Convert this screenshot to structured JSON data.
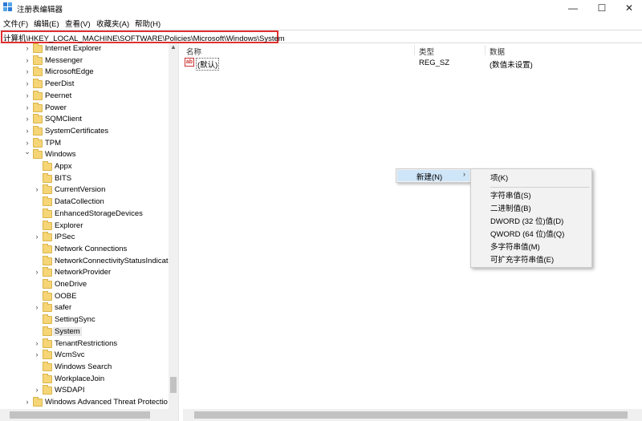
{
  "window": {
    "title": "注册表编辑器",
    "min_glyph": "—",
    "max_glyph": "☐",
    "close_glyph": "✕"
  },
  "menubar": [
    "文件(F)",
    "编辑(E)",
    "查看(V)",
    "收藏夹(A)",
    "帮助(H)"
  ],
  "address": "计算机\\HKEY_LOCAL_MACHINE\\SOFTWARE\\Policies\\Microsoft\\Windows\\System",
  "tree": [
    {
      "label": "Internet Explorer",
      "expandable": true,
      "level": 0
    },
    {
      "label": "Messenger",
      "expandable": true,
      "level": 0
    },
    {
      "label": "MicrosoftEdge",
      "expandable": true,
      "level": 0
    },
    {
      "label": "PeerDist",
      "expandable": true,
      "level": 0
    },
    {
      "label": "Peernet",
      "expandable": true,
      "level": 0
    },
    {
      "label": "Power",
      "expandable": true,
      "level": 0
    },
    {
      "label": "SQMClient",
      "expandable": true,
      "level": 0
    },
    {
      "label": "SystemCertificates",
      "expandable": true,
      "level": 0
    },
    {
      "label": "TPM",
      "expandable": true,
      "level": 0
    },
    {
      "label": "Windows",
      "expandable": true,
      "expanded": true,
      "level": 0
    },
    {
      "label": "Appx",
      "expandable": false,
      "level": 1
    },
    {
      "label": "BITS",
      "expandable": false,
      "level": 1
    },
    {
      "label": "CurrentVersion",
      "expandable": true,
      "level": 1
    },
    {
      "label": "DataCollection",
      "expandable": false,
      "level": 1
    },
    {
      "label": "EnhancedStorageDevices",
      "expandable": false,
      "level": 1
    },
    {
      "label": "Explorer",
      "expandable": false,
      "level": 1
    },
    {
      "label": "IPSec",
      "expandable": true,
      "level": 1
    },
    {
      "label": "Network Connections",
      "expandable": false,
      "level": 1
    },
    {
      "label": "NetworkConnectivityStatusIndicat",
      "expandable": false,
      "level": 1
    },
    {
      "label": "NetworkProvider",
      "expandable": true,
      "level": 1
    },
    {
      "label": "OneDrive",
      "expandable": false,
      "level": 1
    },
    {
      "label": "OOBE",
      "expandable": false,
      "level": 1
    },
    {
      "label": "safer",
      "expandable": true,
      "level": 1
    },
    {
      "label": "SettingSync",
      "expandable": false,
      "level": 1
    },
    {
      "label": "System",
      "expandable": false,
      "level": 1,
      "selected": true
    },
    {
      "label": "TenantRestrictions",
      "expandable": true,
      "level": 1
    },
    {
      "label": "WcmSvc",
      "expandable": true,
      "level": 1
    },
    {
      "label": "Windows Search",
      "expandable": false,
      "level": 1
    },
    {
      "label": "WorkplaceJoin",
      "expandable": false,
      "level": 1
    },
    {
      "label": "WSDAPI",
      "expandable": true,
      "level": 1
    },
    {
      "label": "Windows Advanced Threat Protectio",
      "expandable": true,
      "level": 0
    }
  ],
  "list": {
    "headers": {
      "name": "名称",
      "type": "类型",
      "data": "数据"
    },
    "rows": [
      {
        "icon": "ab",
        "name": "(默认)",
        "type": "REG_SZ",
        "data": "(数值未设置)"
      }
    ]
  },
  "context_menu": {
    "new_label": "新建(N)",
    "arrow": "›"
  },
  "submenu": [
    "项(K)",
    "字符串值(S)",
    "二进制值(B)",
    "DWORD (32 位)值(D)",
    "QWORD (64 位)值(Q)",
    "多字符串值(M)",
    "可扩充字符串值(E)"
  ]
}
